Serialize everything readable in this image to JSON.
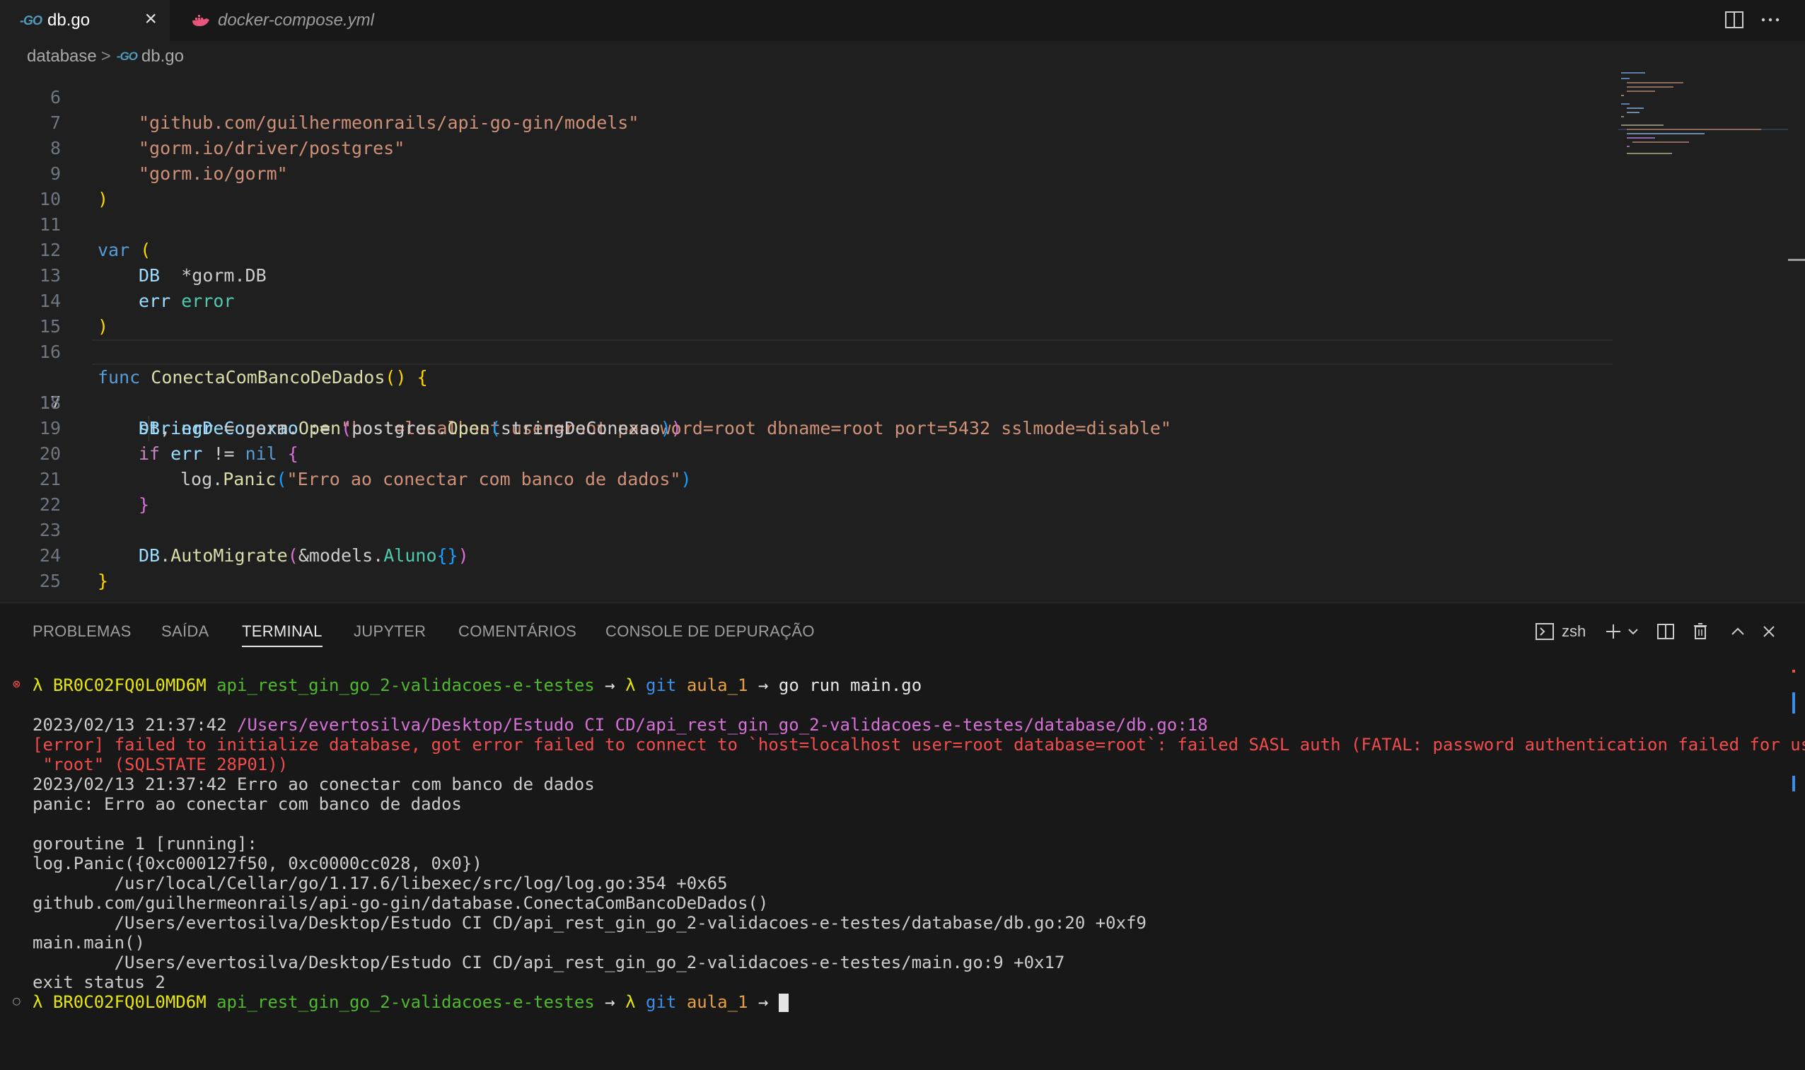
{
  "tabs": [
    {
      "icon": "go-icon",
      "badge": "-GO",
      "label": "db.go",
      "close": "×"
    },
    {
      "icon": "docker-icon",
      "label": "docker-compose.yml"
    }
  ],
  "breadcrumb": {
    "folder": "database",
    "separator": ">",
    "badge": "-GO",
    "file": "db.go"
  },
  "editor": {
    "partial_line": {
      "number": "6",
      "text": "\"github.com/guilhermeonrails/api-go-gin/models\""
    },
    "line_numbers": [
      "7",
      "8",
      "9",
      "10",
      "11",
      "12",
      "13",
      "14",
      "15",
      "16",
      "17",
      "18",
      "19",
      "20",
      "21",
      "22",
      "23",
      "24",
      "25"
    ],
    "tokens": {
      "l7": "\"gorm.io/driver/postgres\"",
      "l8": "\"gorm.io/gorm\"",
      "paren_close": ")",
      "var_kw": "var",
      "paren_open": "(",
      "db_name": "DB",
      "db_type_star": "*gorm.",
      "db_type_name": "DB",
      "err_name": "err",
      "err_type": "error",
      "func_kw": "func",
      "func_name": "ConectaComBancoDeDados",
      "func_parens": "()",
      "brace_open": "{",
      "brace_close": "}",
      "conn_var": "stringDeConexao",
      "assign_op": ":=",
      "conn_string": "\"host=localhost user=root password=root dbname=root port=5432 sslmode=disable\"",
      "l18_db": "DB",
      "comma": ",",
      "l18_err": "err",
      "eq": "=",
      "gorm_pkg": "gorm",
      "dot": ".",
      "open_fn": "Open",
      "postgres_pkg": "postgres",
      "if_kw": "if",
      "neq": "!=",
      "nil_kw": "nil",
      "log_pkg": "log",
      "panic_fn": "Panic",
      "panic_msg": "\"Erro ao conectar com banco de dados\"",
      "automigrate_fn": "AutoMigrate",
      "amp_models": "&models.",
      "aluno_type": "Aluno",
      "empty_braces": "{}"
    },
    "current_line": "17"
  },
  "panel": {
    "tabs": [
      "PROBLEMAS",
      "SAÍDA",
      "TERMINAL",
      "JUPYTER",
      "COMENTÁRIOS",
      "CONSOLE DE DEPURAÇÃO"
    ],
    "active_tab": "TERMINAL",
    "shell": "zsh",
    "actions": [
      "new-terminal",
      "split-terminal",
      "kill-terminal",
      "maximize-panel",
      "close-panel"
    ]
  },
  "terminal": {
    "prompt1": {
      "status": "⊗",
      "lambda": "λ",
      "host": "BR0C02FQ0L0MD6M",
      "dir": "api_rest_gin_go_2-validacoes-e-testes",
      "arrow": "→",
      "lambda2": "λ",
      "git": "git",
      "branch": "aula_1",
      "arrow2": "→",
      "command": "go run main.go"
    },
    "log1_time": "2023/02/13 21:37:42",
    "log1_path": "/Users/evertosilva/Desktop/Estudo CI CD/api_rest_gin_go_2-validacoes-e-testes/database/db.go:18",
    "error_tag": "[error]",
    "error_msg_1": " failed to initialize database, got error failed to connect to `host=localhost user=root database=root`: failed SASL auth (FATAL: password authentication failed for user",
    "error_msg_2": " \"root\" (SQLSTATE 28P01))",
    "log2": "2023/02/13 21:37:42 Erro ao conectar com banco de dados",
    "panic": "panic: Erro ao conectar com banco de dados",
    "goroutine": "goroutine 1 [running]:",
    "trace": [
      "log.Panic({0xc000127f50, 0xc0000cc028, 0x0})",
      "        /usr/local/Cellar/go/1.17.6/libexec/src/log/log.go:354 +0x65",
      "github.com/guilhermeonrails/api-go-gin/database.ConectaComBancoDeDados()",
      "        /Users/evertosilva/Desktop/Estudo CI CD/api_rest_gin_go_2-validacoes-e-testes/database/db.go:20 +0xf9",
      "main.main()",
      "        /Users/evertosilva/Desktop/Estudo CI CD/api_rest_gin_go_2-validacoes-e-testes/main.go:9 +0x17"
    ],
    "exit": "exit status 2",
    "prompt2": {
      "status": "○",
      "lambda": "λ",
      "host": "BR0C02FQ0L0MD6M",
      "dir": "api_rest_gin_go_2-validacoes-e-testes",
      "arrow": "→",
      "lambda2": "λ",
      "git": "git",
      "branch": "aula_1",
      "arrow2": "→"
    }
  },
  "colors": {
    "editor_bg": "#1f1f1f",
    "panel_bg": "#181818",
    "keyword": "#569cd6",
    "string": "#ce9178",
    "function": "#dcdcaa",
    "variable": "#9cdcfe",
    "type": "#4ec9b0",
    "terminal_host": "#e5e510",
    "terminal_dir": "#4fb82c",
    "terminal_error": "#f14c4c"
  }
}
